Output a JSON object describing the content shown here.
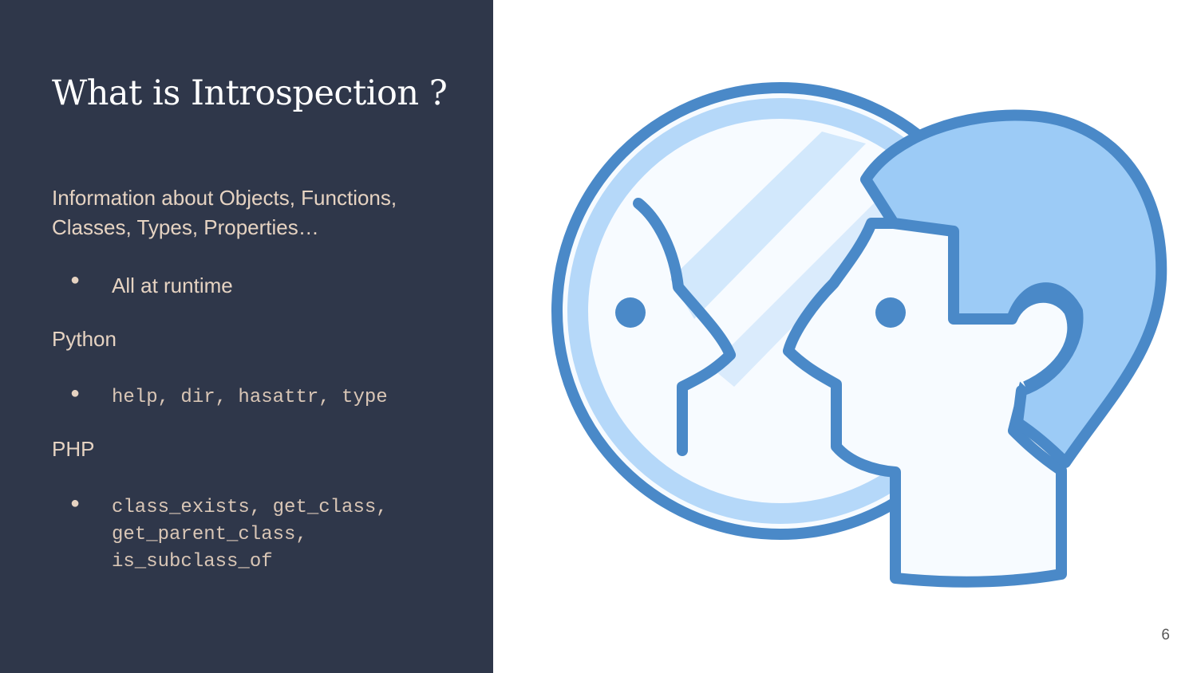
{
  "slide": {
    "title": "What is Introspection ?",
    "intro": "Information about Objects, Functions, Classes, Types, Properties…",
    "intro_bullet": "All at runtime",
    "sections": [
      {
        "label": "Python",
        "code": "help, dir, hasattr, type"
      },
      {
        "label": "PHP",
        "code": "class_exists, get_class,\nget_parent_class,\nis_subclass_of"
      }
    ],
    "bullet_glyph": "●",
    "page_number": "6",
    "illustration_icon": "introspection-mirror-icon"
  },
  "colors": {
    "panel_background": "#2f374a",
    "title_text": "#ffffff",
    "body_text": "#e6d3c2",
    "icon_stroke": "#4a89c8",
    "icon_fill_light": "#b5d8f9",
    "icon_fill_mid": "#9ccbf6",
    "icon_fill_white": "#f7fbff"
  }
}
